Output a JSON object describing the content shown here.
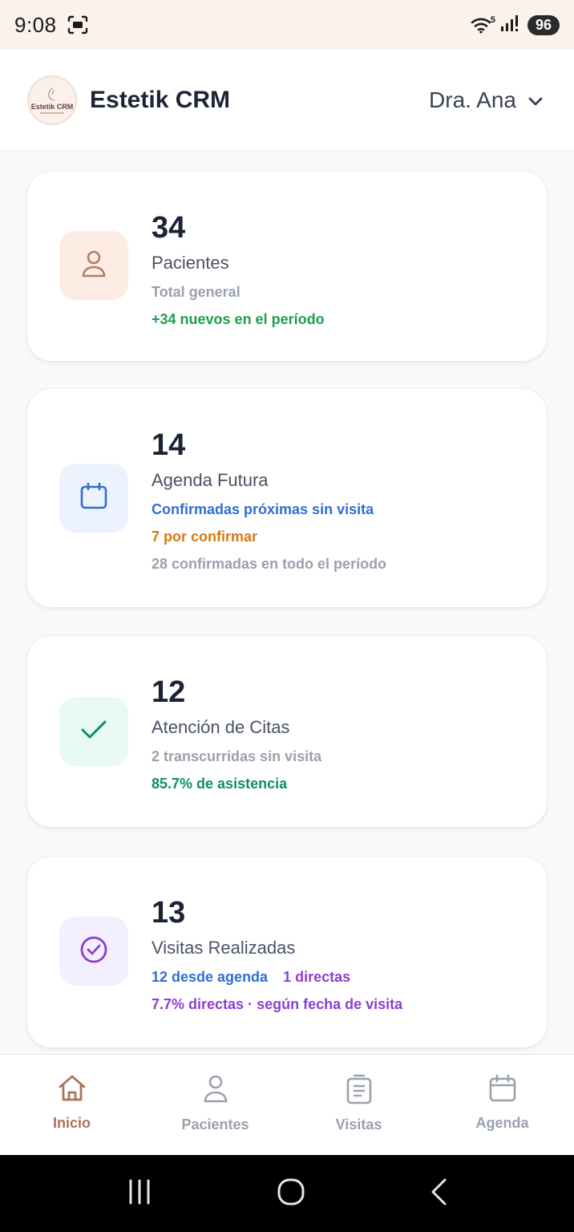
{
  "status_bar": {
    "time": "9:08",
    "battery": "96",
    "network_superscript": "5"
  },
  "header": {
    "app_name": "Estetik CRM",
    "logo_text": "Estetik CRM",
    "user": "Dra. Ana"
  },
  "cards": [
    {
      "number": "34",
      "label": "Pacientes",
      "icon": "user-icon",
      "accent": "#a9745d",
      "lines": [
        [
          {
            "text": "Total general",
            "color": "gray"
          }
        ],
        [
          {
            "text": "+34 nuevos en el período",
            "color": "green"
          }
        ]
      ]
    },
    {
      "number": "14",
      "label": "Agenda Futura",
      "icon": "calendar-icon",
      "accent": "#2f6fd0",
      "lines": [
        [
          {
            "text": "Confirmadas próximas sin visita",
            "color": "blue"
          }
        ],
        [
          {
            "text": "7 por confirmar",
            "color": "orange"
          }
        ],
        [
          {
            "text": "28 confirmadas en todo el período",
            "color": "gray"
          }
        ]
      ]
    },
    {
      "number": "12",
      "label": "Atención de Citas",
      "icon": "check-icon",
      "accent": "#0e8f66",
      "lines": [
        [
          {
            "text": "2 transcurridas sin visita",
            "color": "gray"
          }
        ],
        [
          {
            "text": "85.7% de asistencia",
            "color": "teal"
          }
        ]
      ]
    },
    {
      "number": "13",
      "label": "Visitas Realizadas",
      "icon": "check-circle-icon",
      "accent": "#8a3fd1",
      "lines": [
        [
          {
            "text": "12 desde agenda",
            "color": "blue"
          },
          {
            "text": "1 directas",
            "color": "purple"
          }
        ],
        [
          {
            "text": "7.7% directas · según fecha de visita",
            "color": "purple"
          }
        ]
      ]
    }
  ],
  "bottom_nav": {
    "active": "Inicio",
    "items": [
      {
        "label": "Inicio",
        "icon": "home-icon"
      },
      {
        "label": "Pacientes",
        "icon": "user-icon"
      },
      {
        "label": "Visitas",
        "icon": "clipboard-icon"
      },
      {
        "label": "Agenda",
        "icon": "calendar-icon"
      }
    ]
  },
  "colors": {
    "brand": "#a9745d",
    "status_bar_bg": "#fcf2ec",
    "page_bg": "#f8f9fb"
  }
}
